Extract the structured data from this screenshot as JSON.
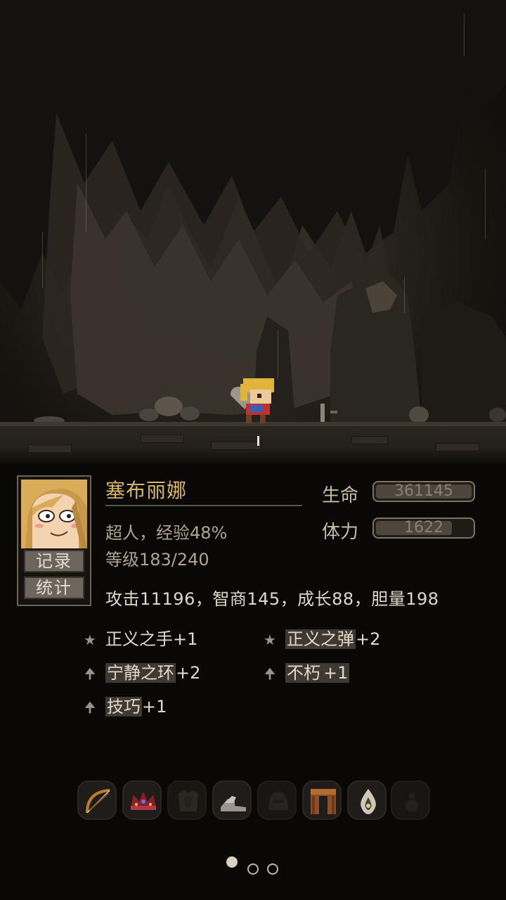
{
  "character": {
    "name": "塞布丽娜",
    "title_line": "超人，经验48%",
    "level_line": "等级183/240",
    "stats_line": "攻击11196，智商145，成长88，胆量198"
  },
  "side_buttons": {
    "records": "记录",
    "stats": "统计"
  },
  "meters": {
    "hp_label": "生命",
    "hp_value": "361145",
    "hp_fraction": 1.0,
    "stamina_label": "体力",
    "stamina_value": "1622",
    "stamina_fraction": 0.8
  },
  "skills": [
    {
      "icon": "star-icon",
      "glyph": "★",
      "name": "正义之手",
      "bonus": "+1"
    },
    {
      "icon": "star-icon",
      "glyph": "★",
      "name": "正义之弹",
      "bonus": "+2"
    },
    {
      "icon": "arrow-up-icon",
      "glyph": "🠉",
      "name": "宁静之环",
      "bonus": "+2"
    },
    {
      "icon": "arrow-up-icon",
      "glyph": "🠉",
      "name": "不朽",
      "bonus": "+1"
    },
    {
      "icon": "arrow-up-icon",
      "glyph": "🠉",
      "name": "技巧",
      "bonus": "+1"
    }
  ],
  "equipment": [
    {
      "icon": "bow-icon",
      "active": true
    },
    {
      "icon": "crown-icon",
      "active": true
    },
    {
      "icon": "armor-icon",
      "active": false
    },
    {
      "icon": "boots-icon",
      "active": true
    },
    {
      "icon": "helmet-icon",
      "active": false
    },
    {
      "icon": "cloak-icon",
      "active": true
    },
    {
      "icon": "amulet-icon",
      "active": true
    },
    {
      "icon": "potion-icon",
      "active": false
    }
  ],
  "pager": {
    "pages": 3,
    "current": 1
  },
  "colors": {
    "name_gold": "#d7b766",
    "panel_bg": "#0a0807",
    "meter_border": "#7c7264"
  }
}
